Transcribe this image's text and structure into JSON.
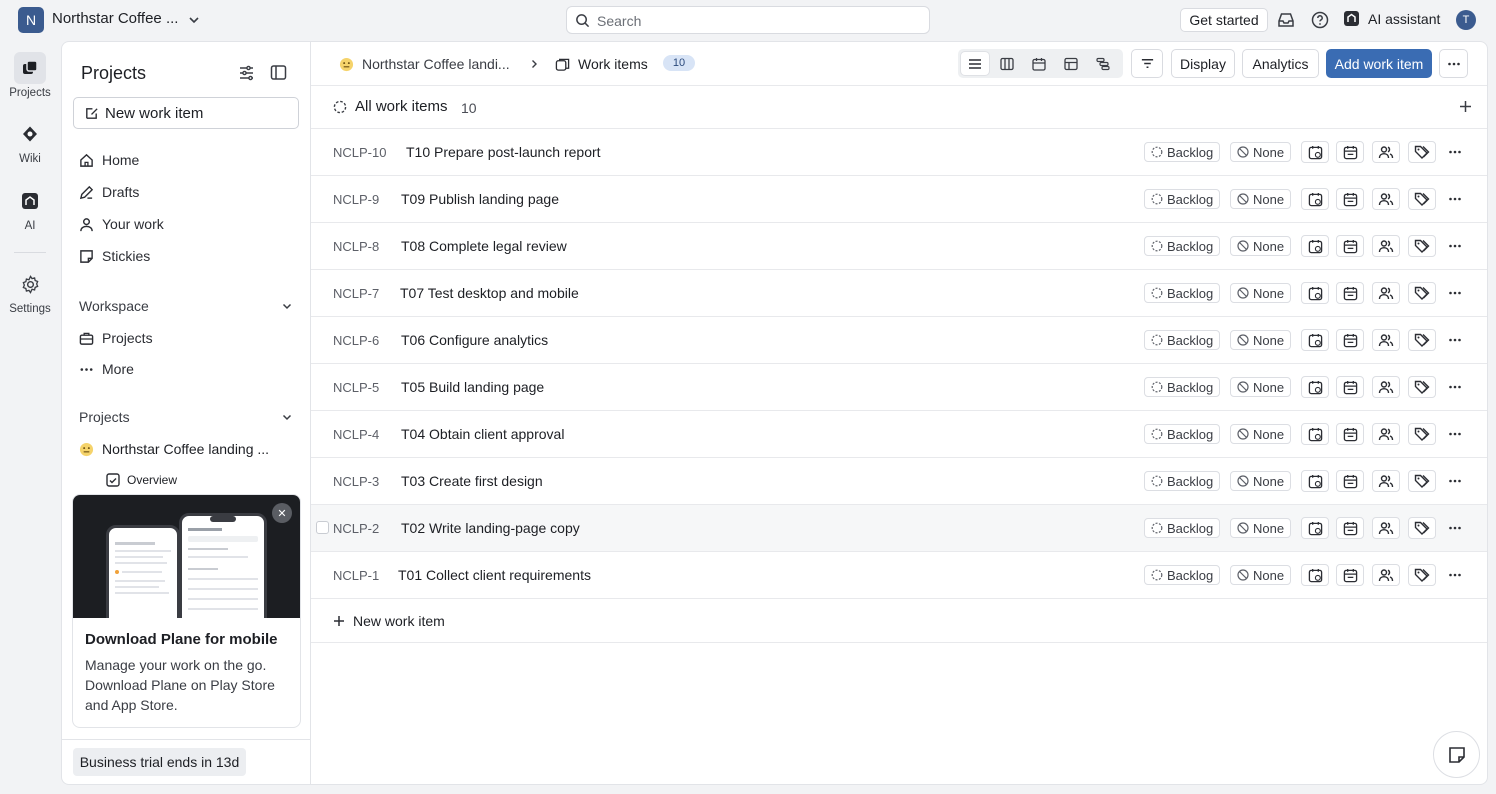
{
  "topbar": {
    "workspace_initial": "N",
    "workspace_name": "Northstar Coffee ...",
    "search_placeholder": "Search",
    "get_started": "Get started",
    "ai_assistant": "AI assistant",
    "user_initial": "T"
  },
  "rail": {
    "projects": "Projects",
    "wiki": "Wiki",
    "ai": "AI",
    "settings": "Settings"
  },
  "sidebar": {
    "title": "Projects",
    "new_work_item": "New work item",
    "nav": {
      "home": "Home",
      "drafts": "Drafts",
      "your_work": "Your work",
      "stickies": "Stickies"
    },
    "workspace_label": "Workspace",
    "workspace_projects": "Projects",
    "workspace_more": "More",
    "projects_label": "Projects",
    "project_name": "Northstar Coffee landing ...",
    "overview": "Overview",
    "promo": {
      "title": "Download Plane for mobile",
      "body": "Manage your work on the go. Download Plane on Play Store and App Store."
    },
    "trial": "Business trial ends in 13d"
  },
  "header": {
    "project_crumb": "Northstar Coffee landi...",
    "work_items": "Work items",
    "count": "10",
    "display": "Display",
    "analytics": "Analytics",
    "add_work_item": "Add work item"
  },
  "view": {
    "title": "All work items",
    "count": "10"
  },
  "rows": [
    {
      "id": "NCLP-10",
      "title": "T10 Prepare post-launch report",
      "state": "Backlog",
      "priority": "None"
    },
    {
      "id": "NCLP-9",
      "title": "T09 Publish landing page",
      "state": "Backlog",
      "priority": "None"
    },
    {
      "id": "NCLP-8",
      "title": "T08 Complete legal review",
      "state": "Backlog",
      "priority": "None"
    },
    {
      "id": "NCLP-7",
      "title": "T07 Test desktop and mobile",
      "state": "Backlog",
      "priority": "None"
    },
    {
      "id": "NCLP-6",
      "title": "T06 Configure analytics",
      "state": "Backlog",
      "priority": "None"
    },
    {
      "id": "NCLP-5",
      "title": "T05 Build landing page",
      "state": "Backlog",
      "priority": "None"
    },
    {
      "id": "NCLP-4",
      "title": "T04 Obtain client approval",
      "state": "Backlog",
      "priority": "None"
    },
    {
      "id": "NCLP-3",
      "title": "T03 Create first design",
      "state": "Backlog",
      "priority": "None"
    },
    {
      "id": "NCLP-2",
      "title": "T02 Write landing-page copy",
      "state": "Backlog",
      "priority": "None"
    },
    {
      "id": "NCLP-1",
      "title": "T01 Collect client requirements",
      "state": "Backlog",
      "priority": "None"
    }
  ],
  "new_row_label": "New work item",
  "colors": {
    "accent": "#3a6cb3",
    "workspace": "#3b5b8f",
    "badge_bg": "#d8e4f6"
  }
}
